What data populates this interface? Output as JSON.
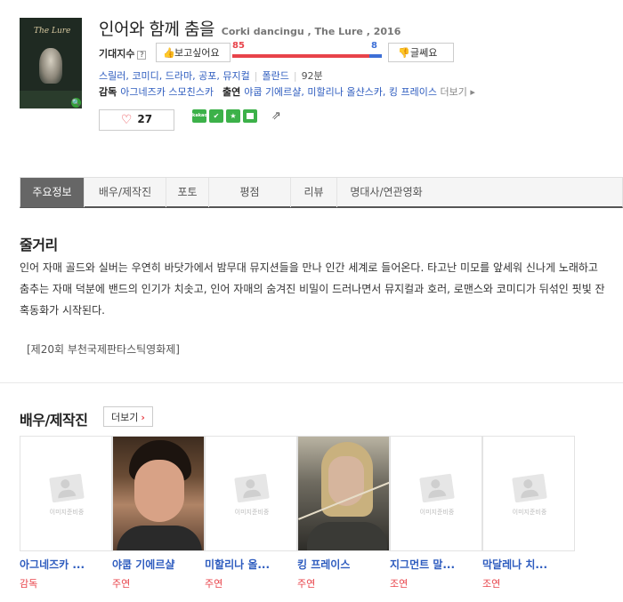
{
  "movie": {
    "poster_text": "The Lure",
    "title": "인어와 함께 춤을",
    "subtitle": "Corki dancingu , The Lure , 2016",
    "expect_label": "기대지수",
    "expect_help": "?",
    "want_btn": "보고싶어요",
    "nope_btn": "글쎄요",
    "score_want": "85",
    "score_nope": "8",
    "want_fraction": 0.914,
    "genres": [
      "스릴러",
      "코미디",
      "드라마",
      "공포",
      "뮤지컬"
    ],
    "country": "폴란드",
    "runtime": "92분",
    "director_label": "감독",
    "director": "아그네즈카 스모친스카",
    "cast_label": "출연",
    "cast_list": "야쿱 기에르샬, 미할리나 올샨스카, 킹 프레이스",
    "cast_more": "더보기 ▸",
    "likes": "27",
    "share_badges": [
      "kakao",
      "band",
      "star",
      "square"
    ],
    "accent_red": "#e8434a",
    "accent_blue": "#3d6fd6",
    "link_blue": "#2e5cbf"
  },
  "tabs": [
    {
      "label": "주요정보",
      "active": true
    },
    {
      "label": "배우/제작진",
      "active": false
    },
    {
      "label": "포토",
      "active": false
    },
    {
      "label": "평점",
      "active": false
    },
    {
      "label": "리뷰",
      "active": false
    },
    {
      "label": "명대사/연관영화",
      "active": false
    }
  ],
  "synopsis": {
    "heading": "줄거리",
    "body": "인어 자매 골드와 실버는 우연히 바닷가에서 밤무대 뮤지션들을 만나 인간 세계로 들어온다. 타고난 미모를 앞세워 신나게 노래하고 춤추는 자매 덕분에 밴드의 인기가 치솟고, 인어 자매의 숨겨진 비밀이 드러나면서 뮤지컬과 호러, 로맨스와 코미디가 뒤섞인 핏빛 잔혹동화가 시작된다.",
    "festival": "[제20회 부천국제판타스틱영화제]"
  },
  "cast": {
    "heading": "배우/제작진",
    "more_btn": "더보기",
    "no_image_text": "이미지준비중",
    "people": [
      {
        "name": "아그네즈카 ...",
        "role": "감독",
        "photo": "none"
      },
      {
        "name": "야쿱 기에르샬",
        "role": "주연",
        "photo": "male"
      },
      {
        "name": "미할리나 올...",
        "role": "주연",
        "photo": "none"
      },
      {
        "name": "킹 프레이스",
        "role": "주연",
        "photo": "female"
      },
      {
        "name": "지그먼트 말...",
        "role": "조연",
        "photo": "none"
      },
      {
        "name": "막달레나 치...",
        "role": "조연",
        "photo": "none"
      }
    ]
  }
}
